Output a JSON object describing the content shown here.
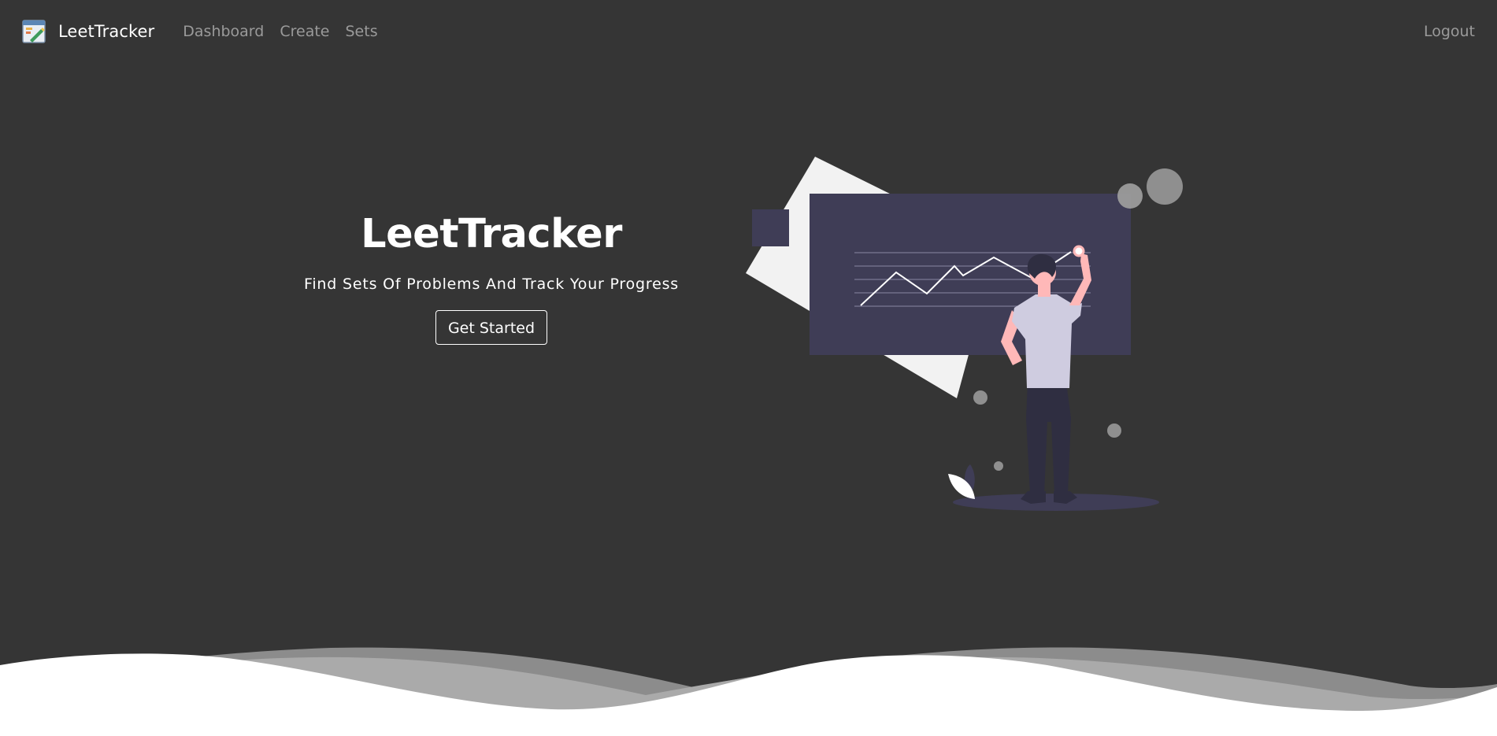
{
  "nav": {
    "brand": "LeetTracker",
    "links": [
      "Dashboard",
      "Create",
      "Sets"
    ],
    "logout": "Logout"
  },
  "hero": {
    "title": "LeetTracker",
    "subtitle": "Find Sets Of Problems And Track Your Progress",
    "cta_label": "Get Started"
  },
  "colors": {
    "background": "#353535",
    "board": "#3f3d56",
    "paper": "#f2f2f2",
    "accent_skin": "#ffb8b8",
    "shirt": "#cfcce0",
    "pants": "#2f2e41",
    "wave_light": "#ffffff",
    "wave_mid": "#aaaaaa",
    "wave_dark": "#8c8c8c"
  },
  "icons": {
    "brand_logo": "chart-notepad-icon"
  }
}
